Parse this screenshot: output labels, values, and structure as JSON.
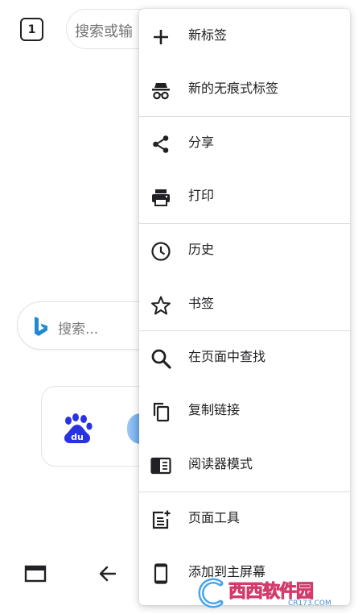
{
  "tab_switcher": {
    "count": "1"
  },
  "address_bar": {
    "placeholder": "搜索或输"
  },
  "bing_search": {
    "placeholder": "搜索..."
  },
  "shortcuts": [
    {
      "name": "baidu",
      "icon": "baidu-logo-icon"
    },
    {
      "name": "second-site",
      "icon": "partial-app-icon"
    }
  ],
  "menu": {
    "items": [
      {
        "id": "new-tab",
        "label": "新标签",
        "icon": "plus-icon"
      },
      {
        "id": "new-incognito-tab",
        "label": "新的无痕式标签",
        "icon": "incognito-icon"
      },
      {
        "id": "share",
        "label": "分享",
        "icon": "share-icon"
      },
      {
        "id": "print",
        "label": "打印",
        "icon": "printer-icon"
      },
      {
        "id": "history",
        "label": "历史",
        "icon": "clock-icon"
      },
      {
        "id": "bookmarks",
        "label": "书签",
        "icon": "star-icon"
      },
      {
        "id": "find-in-page",
        "label": "在页面中查找",
        "icon": "search-icon"
      },
      {
        "id": "copy-link",
        "label": "复制链接",
        "icon": "copy-icon"
      },
      {
        "id": "reader-mode",
        "label": "阅读器模式",
        "icon": "reader-mode-icon"
      },
      {
        "id": "page-tools",
        "label": "页面工具",
        "icon": "page-tools-icon"
      },
      {
        "id": "add-to-home",
        "label": "添加到主屏幕",
        "icon": "phone-icon"
      }
    ]
  },
  "watermark": {
    "main": "西西软件园",
    "url": "CR173.COM"
  },
  "colors": {
    "accent_blue": "#2a6fdb",
    "bing_blue": "#1f8ad0",
    "baidu_blue": "#2932e1"
  }
}
